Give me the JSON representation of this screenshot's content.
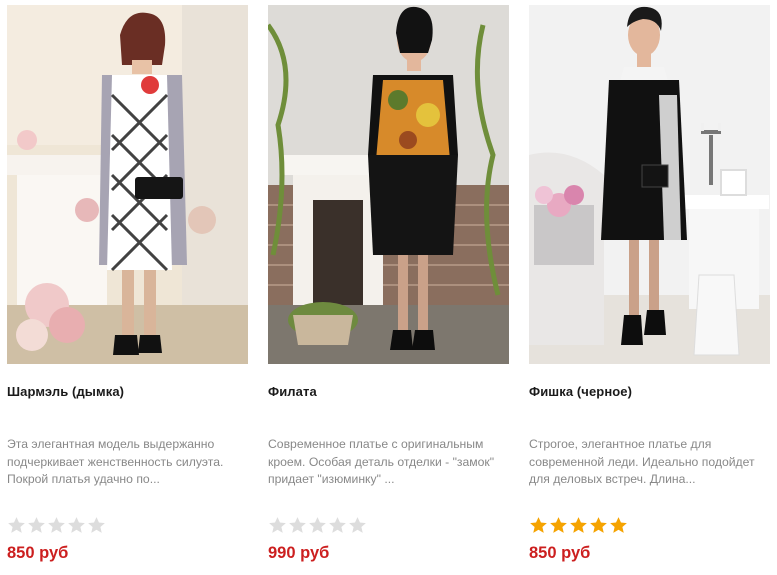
{
  "products": [
    {
      "name": "Шармэль (дымка)",
      "description": "Эта элегантная модель выдержанно подчеркивает женственность силуэта. Покрой платья удачно по...",
      "rating": 0,
      "rating_max": 5,
      "price": "850 руб",
      "image_alt": "photo-sharmel"
    },
    {
      "name": "Филата",
      "description": "Современное платье с оригинальным кроем. Особая деталь отделки - \"замок\" придает \"изюминку\" ...",
      "rating": 0,
      "rating_max": 5,
      "price": "990 руб",
      "image_alt": "photo-filata"
    },
    {
      "name": "Фишка (черное)",
      "description": "Строгое, элегантное платье для современной леди. Идеально подойдет для деловых встреч. Длина...",
      "rating": 5,
      "rating_max": 5,
      "price": "850 руб",
      "image_alt": "photo-fishka"
    }
  ],
  "colors": {
    "price": "#cc1f1f",
    "star_filled": "#f5a300",
    "star_empty": "#dddddd",
    "description": "#888888"
  }
}
